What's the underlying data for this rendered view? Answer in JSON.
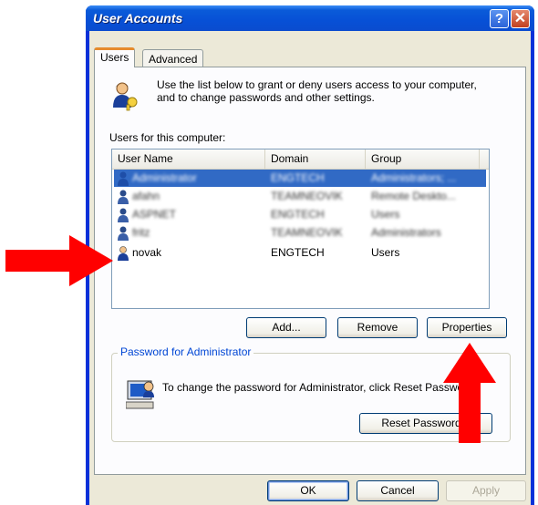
{
  "window": {
    "title": "User Accounts"
  },
  "titlebar": {
    "help_glyph": "?",
    "close_glyph": "✕"
  },
  "tabs": [
    {
      "label": "Users",
      "active": true
    },
    {
      "label": "Advanced",
      "active": false
    }
  ],
  "users_tab": {
    "description": "Use the list below to grant or deny users access to your computer, and to change passwords and other settings.",
    "list_label": "Users for this computer:",
    "columns": [
      "User Name",
      "Domain",
      "Group"
    ],
    "rows": [
      {
        "user": "Administrator",
        "domain": "ENGTECH",
        "group": "Administrators; ...",
        "blurred": true,
        "selected": true
      },
      {
        "user": "afahn",
        "domain": "TEAMNEOVIK",
        "group": "Remote Deskto...",
        "blurred": true,
        "selected": false
      },
      {
        "user": "ASPNET",
        "domain": "ENGTECH",
        "group": "Users",
        "blurred": true,
        "selected": false
      },
      {
        "user": "fritz",
        "domain": "TEAMNEOVIK",
        "group": "Administrators",
        "blurred": true,
        "selected": false
      },
      {
        "user": "novak",
        "domain": "ENGTECH",
        "group": "Users",
        "blurred": false,
        "selected": false
      }
    ],
    "buttons": {
      "add": "Add...",
      "remove": "Remove",
      "properties": "Properties"
    }
  },
  "password_group": {
    "legend": "Password for Administrator",
    "text": "To change the password for Administrator, click Reset Password.",
    "reset_button": "Reset Password..."
  },
  "dialog_buttons": {
    "ok": "OK",
    "cancel": "Cancel",
    "apply": "Apply"
  },
  "colors": {
    "title_blue": "#0a5bd9",
    "selection": "#316ac5",
    "arrow_red": "#ff0000",
    "legend_blue": "#0046d5"
  },
  "icons": [
    "help-icon",
    "close-icon",
    "users-keys-icon",
    "user-account-icon",
    "computer-password-icon",
    "red-arrow-right",
    "red-arrow-up"
  ]
}
